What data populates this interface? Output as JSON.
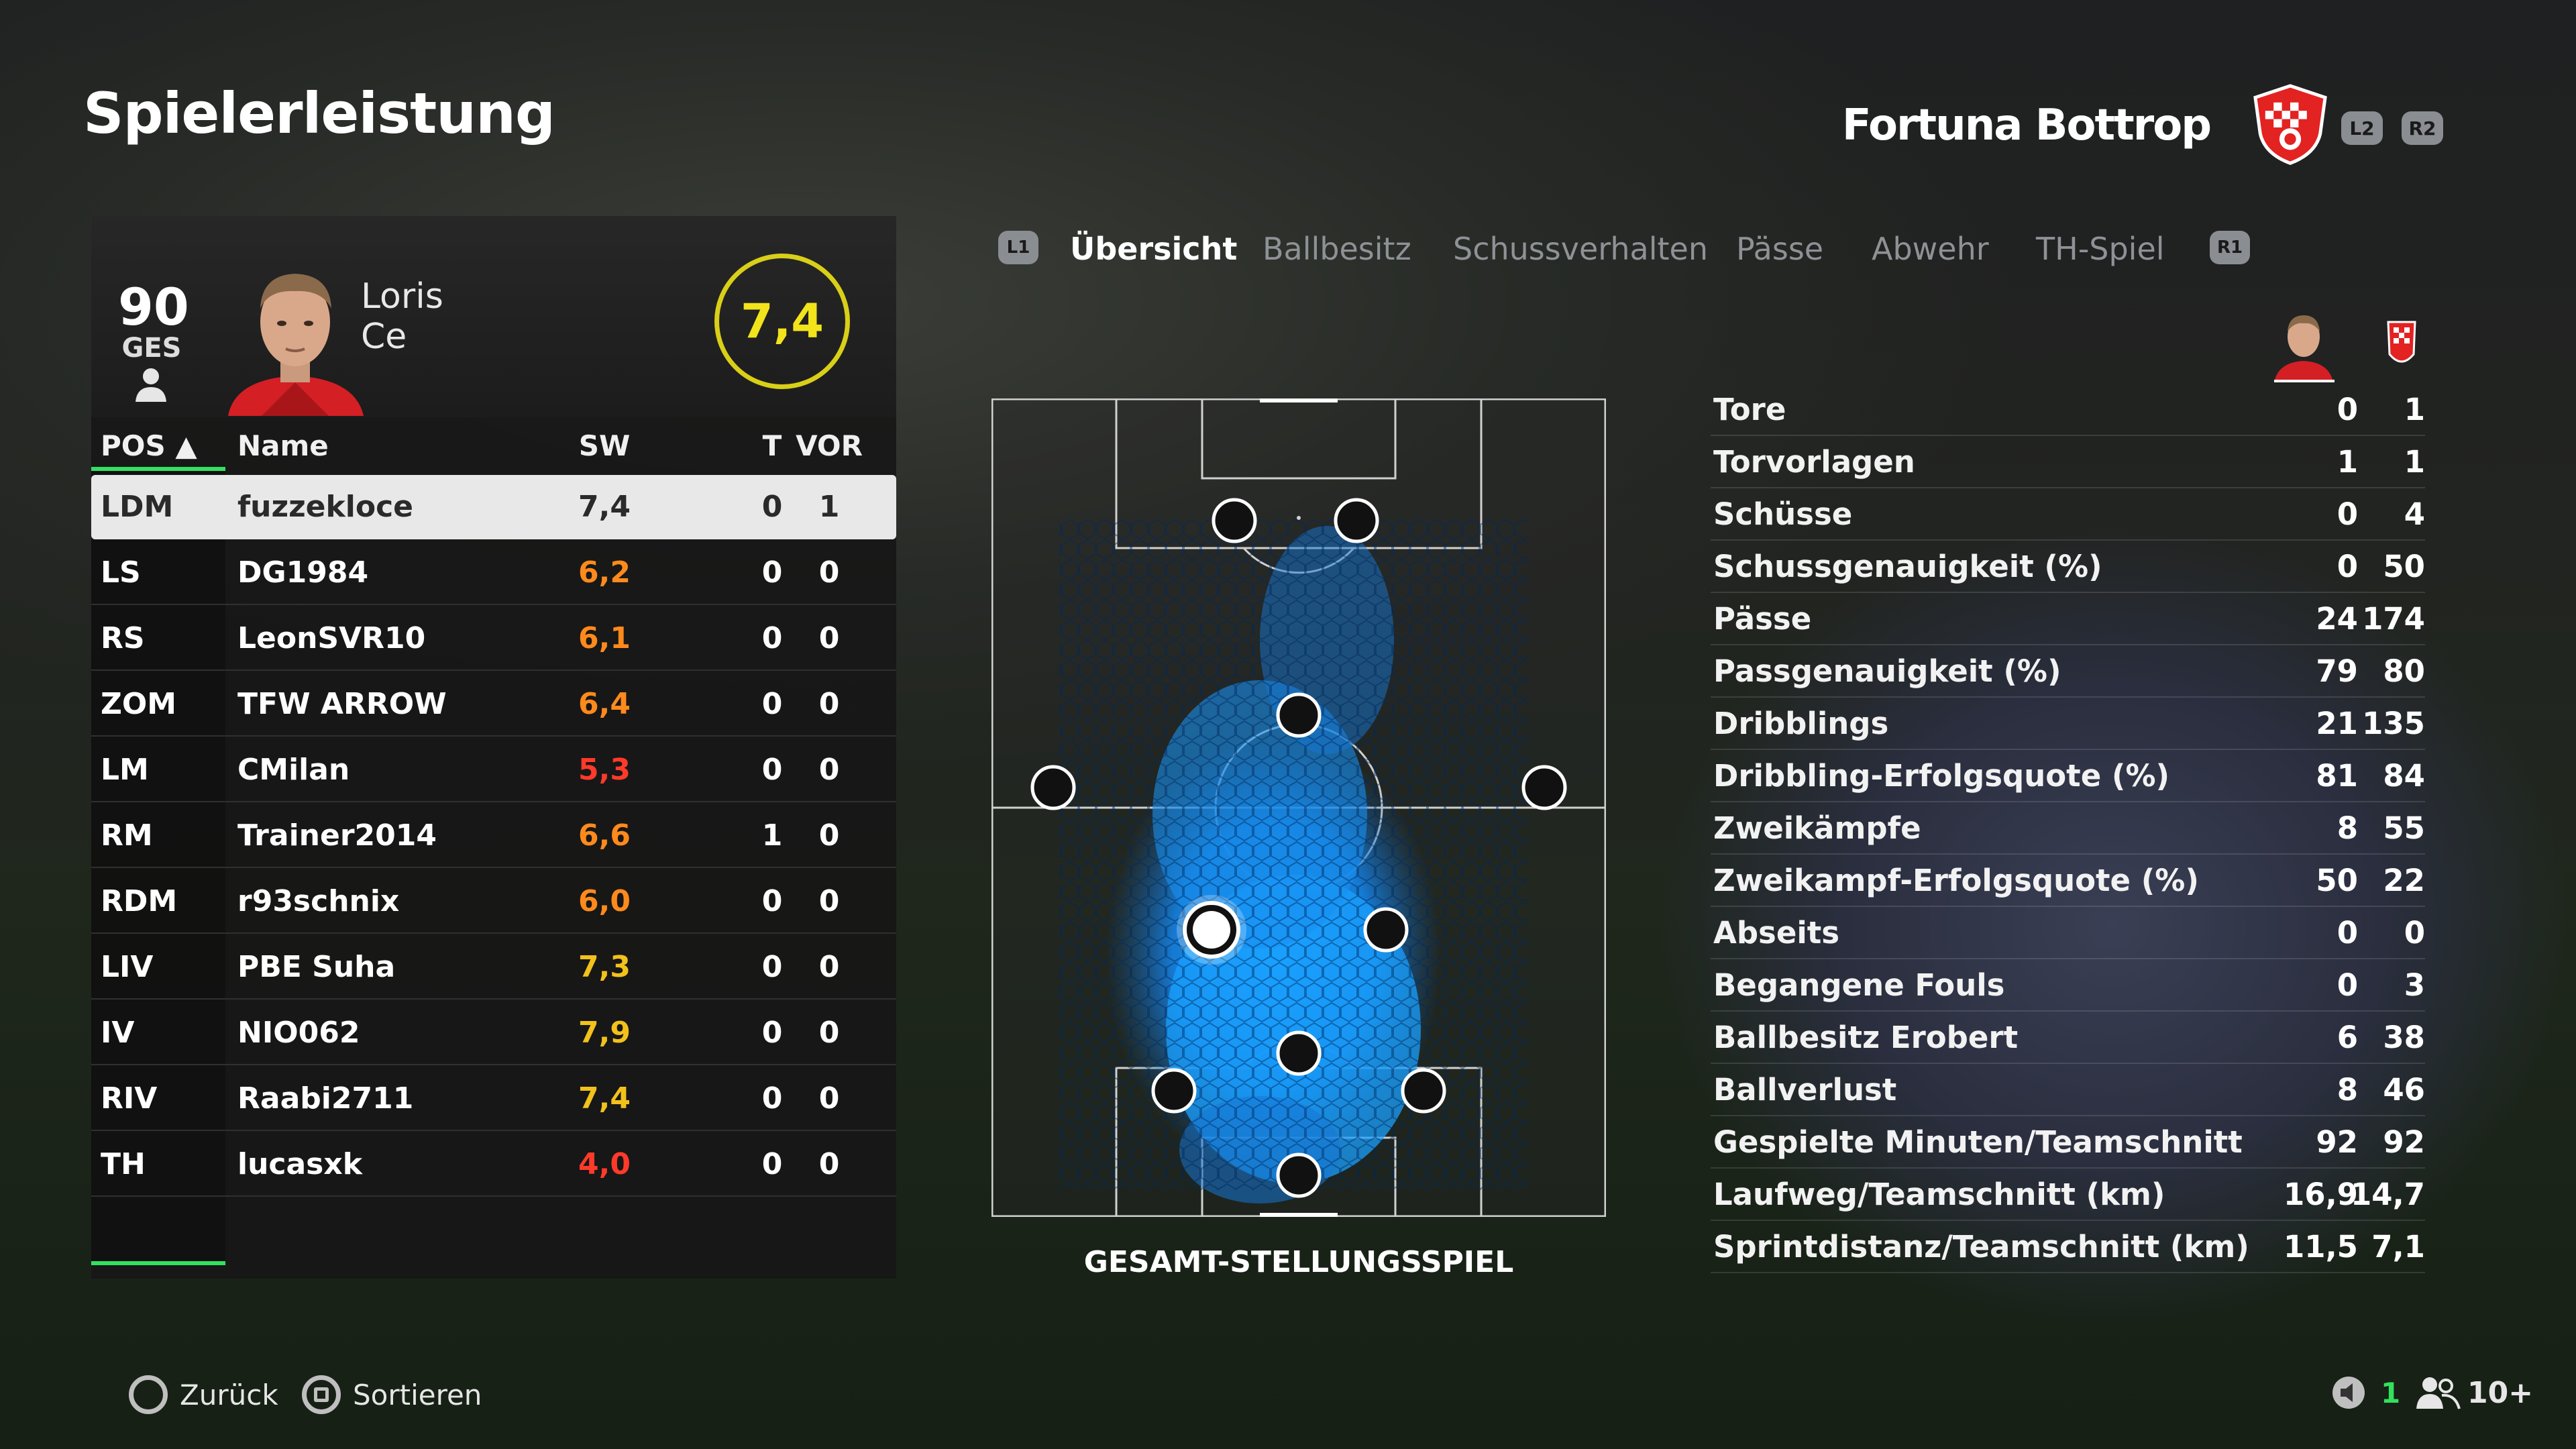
{
  "header": {
    "title": "Spielerleistung",
    "team_name": "Fortuna Bottrop",
    "btn_l2": "L2",
    "btn_r2": "R2"
  },
  "colors": {
    "accent_green": "#33e05e",
    "rating_yellow": "#f2e31b",
    "rating_orange": "#ff8a1c",
    "rating_red": "#ff3a2a",
    "heatmap_blue": "#1aa0ff"
  },
  "player_card": {
    "overall": "90",
    "overall_label": "GES",
    "first_name": "Loris",
    "last_name": "Ce",
    "rating": "7,4",
    "person_icon": "person-icon"
  },
  "table": {
    "headers": {
      "pos": "POS ▲",
      "name": "Name",
      "sw": "SW",
      "t": "T",
      "vor": "VOR"
    },
    "rows": [
      {
        "pos": "LDM",
        "name": "fuzzekloce",
        "sw": "7,4",
        "t": "0",
        "vor": "1",
        "color": "#2a2a2a"
      },
      {
        "pos": "LS",
        "name": "DG1984",
        "sw": "6,2",
        "t": "0",
        "vor": "0",
        "color": "#ff8a1c"
      },
      {
        "pos": "RS",
        "name": "LeonSVR10",
        "sw": "6,1",
        "t": "0",
        "vor": "0",
        "color": "#ff8a1c"
      },
      {
        "pos": "ZOM",
        "name": "TFW ARROW",
        "sw": "6,4",
        "t": "0",
        "vor": "0",
        "color": "#ff8a1c"
      },
      {
        "pos": "LM",
        "name": "CMilan",
        "sw": "5,3",
        "t": "0",
        "vor": "0",
        "color": "#ff3a2a"
      },
      {
        "pos": "RM",
        "name": "Trainer2014",
        "sw": "6,6",
        "t": "1",
        "vor": "0",
        "color": "#ff8a1c"
      },
      {
        "pos": "RDM",
        "name": "r93schnix",
        "sw": "6,0",
        "t": "0",
        "vor": "0",
        "color": "#ff8a1c"
      },
      {
        "pos": "LIV",
        "name": "PBE Suha",
        "sw": "7,3",
        "t": "0",
        "vor": "0",
        "color": "#f2c11b"
      },
      {
        "pos": "IV",
        "name": "NIO062",
        "sw": "7,9",
        "t": "0",
        "vor": "0",
        "color": "#f2c11b"
      },
      {
        "pos": "RIV",
        "name": "Raabi2711",
        "sw": "7,4",
        "t": "0",
        "vor": "0",
        "color": "#f2c11b"
      },
      {
        "pos": "TH",
        "name": "lucasxk",
        "sw": "4,0",
        "t": "0",
        "vor": "0",
        "color": "#ff3a2a"
      }
    ]
  },
  "tabs": {
    "l1": "L1",
    "r1": "R1",
    "items": [
      "Übersicht",
      "Ballbesitz",
      "Schussverhalten",
      "Pässe",
      "Abwehr",
      "TH-Spiel"
    ],
    "active_index": 0
  },
  "pitch": {
    "caption": "GESAMT-STELLUNGSSPIEL"
  },
  "stats": [
    {
      "label": "Tore",
      "player": "0",
      "team": "1"
    },
    {
      "label": "Torvorlagen",
      "player": "1",
      "team": "1"
    },
    {
      "label": "Schüsse",
      "player": "0",
      "team": "4"
    },
    {
      "label": "Schussgenauigkeit (%)",
      "player": "0",
      "team": "50"
    },
    {
      "label": "Pässe",
      "player": "24",
      "team": "174"
    },
    {
      "label": "Passgenauigkeit (%)",
      "player": "79",
      "team": "80"
    },
    {
      "label": "Dribblings",
      "player": "21",
      "team": "135"
    },
    {
      "label": "Dribbling-Erfolgsquote (%)",
      "player": "81",
      "team": "84"
    },
    {
      "label": "Zweikämpfe",
      "player": "8",
      "team": "55"
    },
    {
      "label": "Zweikampf-Erfolgsquote (%)",
      "player": "50",
      "team": "22"
    },
    {
      "label": "Abseits",
      "player": "0",
      "team": "0"
    },
    {
      "label": "Begangene Fouls",
      "player": "0",
      "team": "3"
    },
    {
      "label": "Ballbesitz Erobert",
      "player": "6",
      "team": "38"
    },
    {
      "label": "Ballverlust",
      "player": "8",
      "team": "46"
    },
    {
      "label": "Gespielte Minuten/Teamschnitt",
      "player": "92",
      "team": "92"
    },
    {
      "label": "Laufweg/Teamschnitt (km)",
      "player": "16,9",
      "team": "14,7"
    },
    {
      "label": "Sprintdistanz/Teamschnitt (km)",
      "player": "11,5",
      "team": "7,1"
    }
  ],
  "footer": {
    "back": "Zurück",
    "sort": "Sortieren",
    "voice_count": "1",
    "players_count": "10+"
  }
}
